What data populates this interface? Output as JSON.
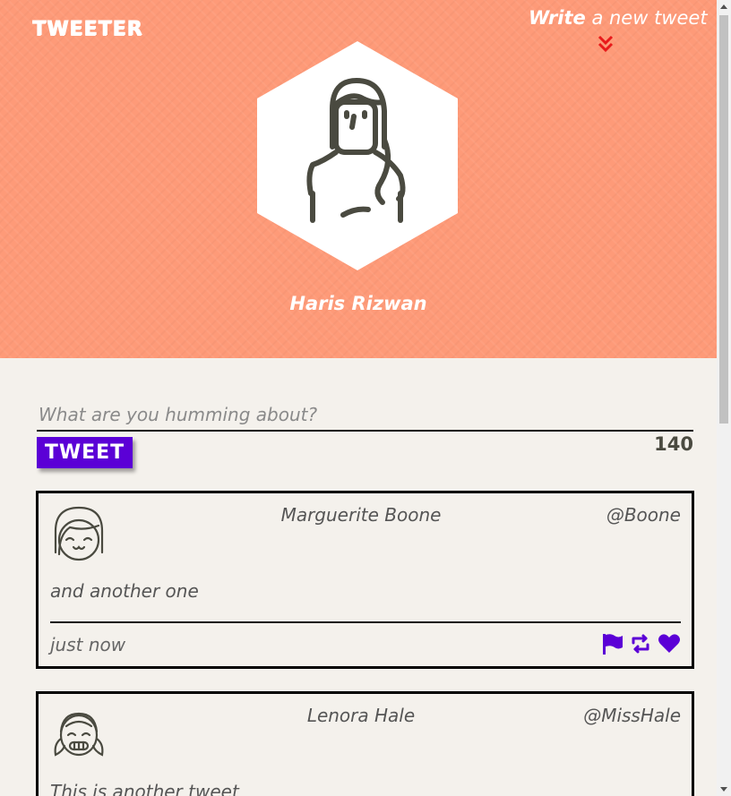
{
  "header": {
    "brand": "TWEETER",
    "write_link_bold": "Write",
    "write_link_rest": " a new tweet",
    "chevron_icon": "chevron-double-down-icon",
    "profile_name": "Haris Rizwan",
    "background_color": "#fe9a78"
  },
  "composer": {
    "placeholder": "What are you humming about?",
    "value": "",
    "submit_label": "TWEET",
    "char_count": "140",
    "accent_color": "#5b00d6"
  },
  "tweets": [
    {
      "name": "Marguerite Boone",
      "handle": "@Boone",
      "text": "and another one",
      "time": "just now",
      "actions": [
        "flag-icon",
        "retweet-icon",
        "heart-icon"
      ]
    },
    {
      "name": "Lenora Hale",
      "handle": "@MissHale",
      "text": "This is another tweet"
    }
  ]
}
